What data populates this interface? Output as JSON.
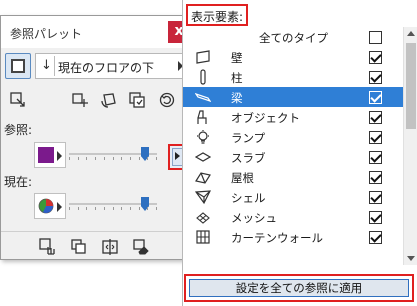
{
  "palette": {
    "title": "参照パレット",
    "close_glyph": "x",
    "floor_button_label": "現在のフロアの下",
    "section_reference_label": "参照:",
    "section_current_label": "現在:",
    "reference_color": "#7b1a8c",
    "reference_slider_level": 0.9,
    "current_slider_level": 0.9,
    "top_tools": [
      "select-arrow-icon",
      "move-cross-icon",
      "rotate-icon",
      "layers-icon",
      "refresh-icon"
    ],
    "bottom_tools": [
      "hand-drag-icon",
      "copy-layer-icon",
      "swap-layer-icon",
      "eraser-icon"
    ]
  },
  "panel": {
    "title": "表示要素:",
    "items": [
      {
        "label": "全てのタイプ",
        "icon": "none",
        "checked": false,
        "selected": false
      },
      {
        "label": "壁",
        "icon": "wall-icon",
        "checked": true,
        "selected": false
      },
      {
        "label": "柱",
        "icon": "column-icon",
        "checked": true,
        "selected": false
      },
      {
        "label": "梁",
        "icon": "beam-icon",
        "checked": true,
        "selected": true
      },
      {
        "label": "オブジェクト",
        "icon": "object-icon",
        "checked": true,
        "selected": false
      },
      {
        "label": "ランプ",
        "icon": "lamp-icon",
        "checked": true,
        "selected": false
      },
      {
        "label": "スラブ",
        "icon": "slab-icon",
        "checked": true,
        "selected": false
      },
      {
        "label": "屋根",
        "icon": "roof-icon",
        "checked": true,
        "selected": false
      },
      {
        "label": "シェル",
        "icon": "shell-icon",
        "checked": true,
        "selected": false
      },
      {
        "label": "メッシュ",
        "icon": "mesh-icon",
        "checked": true,
        "selected": false
      },
      {
        "label": "カーテンウォール",
        "icon": "curtain-wall-icon",
        "checked": true,
        "selected": false
      }
    ],
    "apply_button_label": "設定を全ての参照に適用"
  }
}
